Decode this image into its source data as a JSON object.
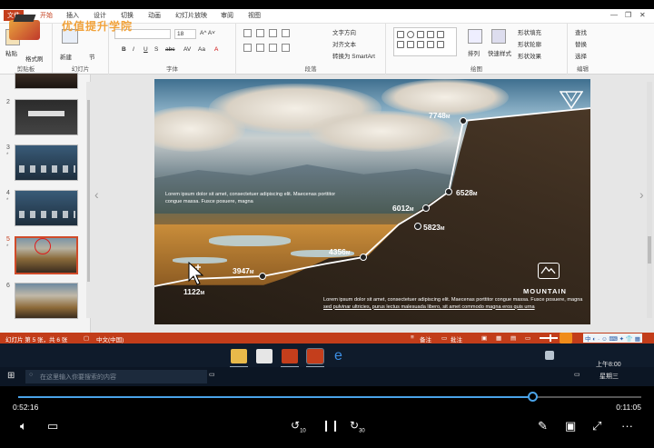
{
  "ribbon": {
    "tabs": [
      "文件",
      "开始",
      "插入",
      "设计",
      "切换",
      "动画",
      "幻灯片放映",
      "审阅",
      "视图"
    ],
    "clipboard": {
      "paste": "粘贴",
      "format_painter": "格式刷",
      "label": "剪贴板"
    },
    "slides": {
      "new_slide": "新建\n幻灯片",
      "section": "节",
      "label": "幻灯片"
    },
    "font": {
      "size": "18",
      "label": "字体"
    },
    "paragraph": {
      "text_direction": "文字方向",
      "align_text": "对齐文本",
      "smartart": "转换为 SmartArt",
      "label": "段落"
    },
    "drawing": {
      "arrange": "排列",
      "quick_styles": "快速样式",
      "shape_fill": "形状填充",
      "shape_outline": "形状轮廓",
      "shape_effects": "形状效果",
      "label": "绘图"
    },
    "editing": {
      "find": "查找",
      "replace": "替换",
      "select": "选择",
      "label": "编辑"
    }
  },
  "watermark": {
    "text": "优值提升学院"
  },
  "thumbnails": [
    {
      "num": "2",
      "star": ""
    },
    {
      "num": "3",
      "star": "*"
    },
    {
      "num": "4",
      "star": "*"
    },
    {
      "num": "5",
      "star": "*"
    },
    {
      "num": "6",
      "star": ""
    }
  ],
  "slide": {
    "points": [
      {
        "value": "7748",
        "unit": "M"
      },
      {
        "value": "6528",
        "unit": "M"
      },
      {
        "value": "6012",
        "unit": "M"
      },
      {
        "value": "5823",
        "unit": "M"
      },
      {
        "value": "4356",
        "unit": "M"
      },
      {
        "value": "3947",
        "unit": "M"
      },
      {
        "value": "1122",
        "unit": "M"
      }
    ],
    "text_left": "Lorem ipsum dolor sit amet, consectetuer adipiscing elit. Maecenas porttitor congue massa. Fusce posuere, magna",
    "text_bottom_1": "Lorem ipsum dolor sit amet, consectetuer adipiscing elit. Maecenas porttitor congue massa. Fusce posuere, magna",
    "text_bottom_2": "sed pulvinar ultricies, purus lectus malesuada libero, sit amet commodo magna eros quis urna",
    "mountain_label": "MOUNTAIN"
  },
  "statusbar": {
    "slide_info": "幻灯片 第 5 张，共 6 张",
    "language": "中文(中国)",
    "notes": "备注",
    "comments": "批注",
    "zoom_percent": 59
  },
  "taskbar": {
    "search_placeholder": "在这里输入你要搜索的内容",
    "time": "上午8:00",
    "date": "星期三"
  },
  "player": {
    "elapsed": "0:52:16",
    "remaining": "0:11:05",
    "progress": 0.825,
    "skip_back": "10",
    "skip_forward": "30"
  },
  "colors": {
    "accent": "#c43e1c",
    "progress": "#4aa3e8",
    "taskbar": "#0f1b2b"
  }
}
